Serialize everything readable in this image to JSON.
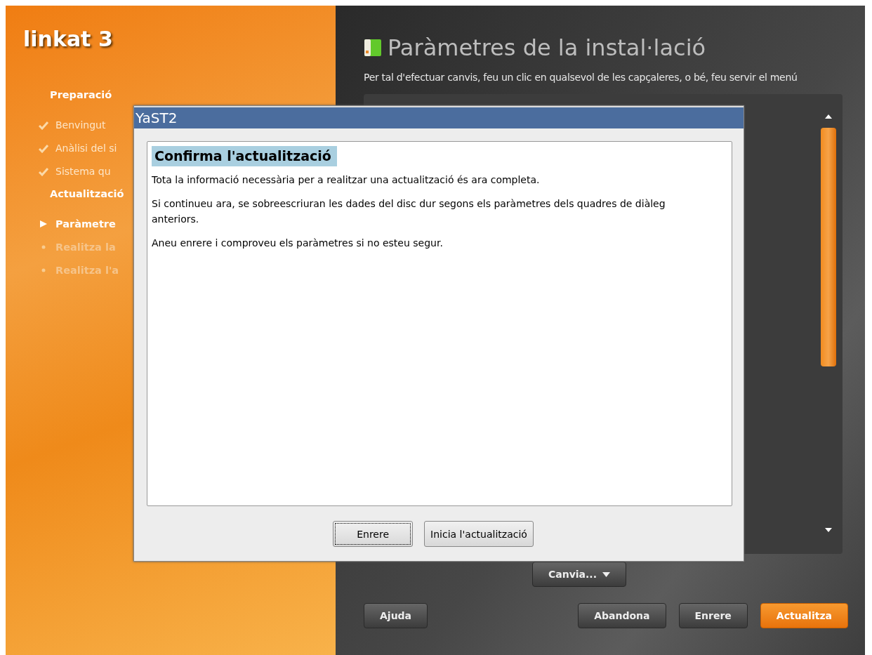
{
  "logo": {
    "text": "linkat 3"
  },
  "sidebar": {
    "sections": [
      {
        "heading": "Preparació",
        "items": [
          {
            "label": "Benvingut",
            "kind": "done"
          },
          {
            "label": "Anàlisi del si",
            "kind": "done"
          },
          {
            "label": "Sistema qu",
            "kind": "done"
          }
        ]
      },
      {
        "heading": "Actualització",
        "items": [
          {
            "label": "Paràmetre",
            "kind": "current"
          },
          {
            "label": "Realitza la",
            "kind": "pending"
          },
          {
            "label": "Realitza l'a",
            "kind": "pending"
          }
        ]
      }
    ]
  },
  "main": {
    "title": "Paràmetres de la instal·lació",
    "subtitle": "Per tal d'efectuar canvis, feu un clic en qualsevol de les capçaleres, o bé, feu servir el menú",
    "change_button": "Canvia...",
    "buttons": [
      {
        "label": "Ajuda",
        "kind": "normal"
      },
      {
        "label": "Abandona",
        "kind": "normal"
      },
      {
        "label": "Enrere",
        "kind": "normal"
      },
      {
        "label": "Actualitza",
        "kind": "default"
      }
    ]
  },
  "dialog": {
    "title": "YaST2",
    "heading": "Confirma l'actualització",
    "paragraphs": [
      "Tota la informació necessària per a realitzar una actualització és ara completa.",
      "Si continueu ara, se sobreescriuran les dades del disc dur segons els paràmetres dels quadres de diàleg anteriors.",
      "Aneu enrere i comproveu els paràmetres si no esteu segur."
    ],
    "buttons": [
      {
        "label": "Enrere",
        "focused": true
      },
      {
        "label": "Inicia l'actualització",
        "focused": false
      }
    ]
  }
}
